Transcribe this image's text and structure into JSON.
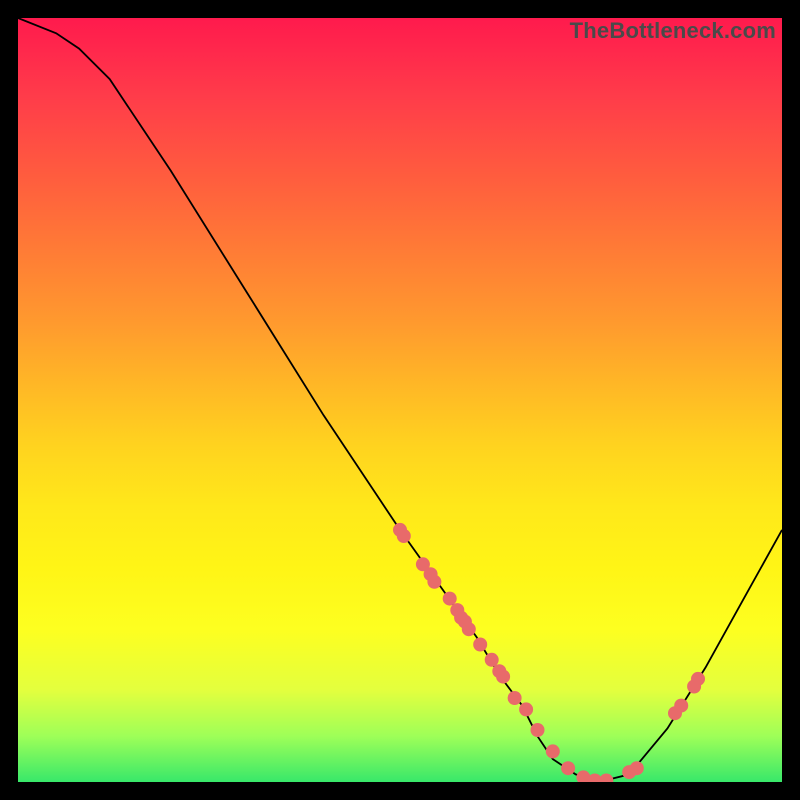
{
  "watermark_text": "TheBottleneck.com",
  "chart_data": {
    "type": "line",
    "title": "",
    "xlabel": "",
    "ylabel": "",
    "xlim": [
      0,
      100
    ],
    "ylim": [
      0,
      100
    ],
    "series": [
      {
        "name": "curve",
        "x": [
          0,
          5,
          8,
          12,
          20,
          30,
          40,
          50,
          55,
          60,
          63,
          66,
          68,
          70,
          73,
          76,
          80,
          85,
          90,
          95,
          100
        ],
        "y": [
          100,
          98,
          96,
          92,
          80,
          64,
          48,
          33,
          26,
          19,
          14,
          10,
          6,
          3,
          1,
          0,
          1,
          7,
          15,
          24,
          33
        ]
      }
    ],
    "scatter_points": {
      "name": "markers",
      "x": [
        50.0,
        50.5,
        53.0,
        54.0,
        54.5,
        56.5,
        57.5,
        58.0,
        58.5,
        59.0,
        60.5,
        62.0,
        63.0,
        63.5,
        65.0,
        66.5,
        68.0,
        70.0,
        72.0,
        74.0,
        75.5,
        77.0,
        80.0,
        81.0,
        86.0,
        86.8,
        88.5,
        89.0
      ],
      "y": [
        33.0,
        32.2,
        28.5,
        27.2,
        26.2,
        24.0,
        22.5,
        21.5,
        21.0,
        20.0,
        18.0,
        16.0,
        14.5,
        13.8,
        11.0,
        9.5,
        6.8,
        4.0,
        1.8,
        0.6,
        0.2,
        0.2,
        1.3,
        1.8,
        9.0,
        10.0,
        12.5,
        13.5
      ]
    },
    "gradient_stops": [
      {
        "pos": 0,
        "color": "#ff1a4d"
      },
      {
        "pos": 20,
        "color": "#ff5a3f"
      },
      {
        "pos": 40,
        "color": "#ff9a2e"
      },
      {
        "pos": 60,
        "color": "#ffe81a"
      },
      {
        "pos": 80,
        "color": "#fdff20"
      },
      {
        "pos": 94,
        "color": "#9eff58"
      },
      {
        "pos": 100,
        "color": "#38e86a"
      }
    ]
  }
}
